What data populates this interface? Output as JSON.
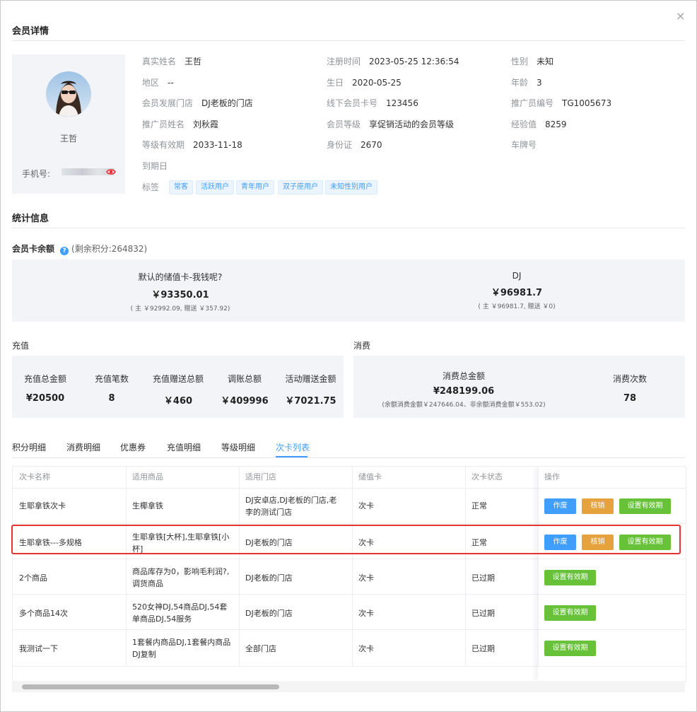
{
  "dialog": {
    "title": "会员详情",
    "close_glyph": "×"
  },
  "profile": {
    "name": "王哲",
    "phone_label": "手机号:"
  },
  "info": {
    "col1": [
      {
        "label": "真实姓名",
        "value": "王哲"
      },
      {
        "label": "地区",
        "value": "--"
      },
      {
        "label": "会员发展门店",
        "value": "DJ老板的门店"
      },
      {
        "label": "推广员姓名",
        "value": "刘秋霞"
      },
      {
        "label": "等级有效期",
        "value": "2033-11-18"
      },
      {
        "label": "到期日",
        "value": ""
      }
    ],
    "col2": [
      {
        "label": "注册时间",
        "value": "2023-05-25 12:36:54"
      },
      {
        "label": "生日",
        "value": "2020-05-25"
      },
      {
        "label": "线下会员卡号",
        "value": "123456"
      },
      {
        "label": "会员等级",
        "value": "享促销活动的会员等级"
      },
      {
        "label": "身份证",
        "value": "2670"
      }
    ],
    "col3": [
      {
        "label": "性别",
        "value": "未知"
      },
      {
        "label": "年龄",
        "value": "3"
      },
      {
        "label": "推广员编号",
        "value": "TG1005673"
      },
      {
        "label": "经验值",
        "value": "8259"
      },
      {
        "label": "车牌号",
        "value": ""
      }
    ],
    "tags_label": "标签",
    "tags": [
      "常客",
      "活跃用户",
      "青年用户",
      "双子座用户",
      "未知性别用户"
    ]
  },
  "stats": {
    "title": "统计信息",
    "balance_label": "会员卡余额",
    "points_note": "(剩余积分:264832)",
    "cards": [
      {
        "name": "默认的储值卡-我钱呢?",
        "amount": "￥93350.01",
        "detail": "( 主 ￥92992.09, 赠送 ￥357.92)"
      },
      {
        "name": "DJ",
        "amount": "￥96981.7",
        "detail": "( 主 ￥96981.7, 赠送 ￥0)"
      }
    ],
    "recharge_label": "充值",
    "recharge": [
      {
        "name": "充值总金额",
        "value": "¥20500"
      },
      {
        "name": "充值笔数",
        "value": "8"
      },
      {
        "name": "充值赠送总额",
        "value": "￥460"
      },
      {
        "name": "调账总额",
        "value": "￥409996"
      },
      {
        "name": "活动赠送金额",
        "value": "￥7021.75"
      }
    ],
    "consume_label": "消费",
    "consume_total_name": "消费总金额",
    "consume_total_value": "¥248199.06",
    "consume_total_detail": "(余额消费金额￥247646.04、非余额消费金额￥553.02)",
    "consume_count_name": "消费次数",
    "consume_count_value": "78"
  },
  "tabs": [
    "积分明细",
    "消费明细",
    "优惠券",
    "充值明细",
    "等级明细",
    "次卡列表"
  ],
  "active_tab": "次卡列表",
  "table": {
    "headers": [
      "次卡名称",
      "适用商品",
      "适用门店",
      "储值卡",
      "次卡状态",
      "操作"
    ],
    "rows": [
      {
        "name": "生耶拿铁次卡",
        "goods": "生椰拿铁",
        "store": "DJ安卓店,DJ老板的门店,老李的测试门店",
        "card": "次卡",
        "status": "正常",
        "buttons": [
          "作废",
          "核销",
          "设置有效期"
        ]
      },
      {
        "name": "生耶拿铁---多规格",
        "goods": "生耶拿铁[大杯],生耶拿铁[小杯]",
        "store": "DJ老板的门店",
        "card": "次卡",
        "status": "正常",
        "buttons": [
          "作废",
          "核销",
          "设置有效期"
        ]
      },
      {
        "name": "2个商品",
        "goods": "商品库存为0，影响毛利润?,调货商品",
        "store": "DJ老板的门店",
        "card": "次卡",
        "status": "已过期",
        "buttons": [
          "设置有效期"
        ]
      },
      {
        "name": "多个商品14次",
        "goods": "520女神DJ,54商品DJ,54套单商品DJ,54服务",
        "store": "DJ老板的门店",
        "card": "次卡",
        "status": "已过期",
        "buttons": [
          "设置有效期"
        ]
      },
      {
        "name": "我测试一下",
        "goods": "1套餐内商品DJ,1套餐内商品DJ复制",
        "store": "全部门店",
        "card": "次卡",
        "status": "已过期",
        "buttons": [
          "设置有效期"
        ]
      }
    ]
  },
  "colors": {
    "primary": "#409eff",
    "warning": "#e6a23c",
    "success": "#67c23a",
    "highlight": "#e8322f"
  }
}
